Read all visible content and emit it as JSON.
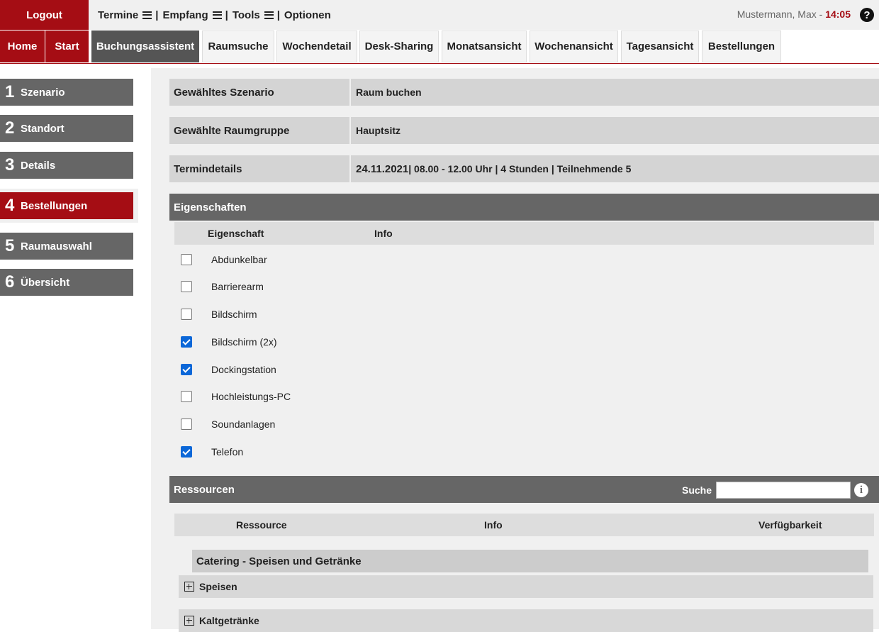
{
  "topbar": {
    "logout": "Logout",
    "menu": [
      {
        "label": "Termine",
        "sep": "|"
      },
      {
        "label": "Empfang",
        "sep": "|"
      },
      {
        "label": "Tools",
        "sep": "|"
      },
      {
        "label": "Optionen"
      }
    ],
    "user": "Mustermann, Max - ",
    "time": "14:05",
    "help": "?"
  },
  "tabs": [
    "Home",
    "Start",
    "Buchungsassistent",
    "Raumsuche",
    "Wochendetail",
    "Desk-Sharing",
    "Monatsansicht",
    "Wochenansicht",
    "Tagesansicht",
    "Bestellungen"
  ],
  "steps": [
    {
      "num": "1",
      "label": "Szenario"
    },
    {
      "num": "2",
      "label": "Standort"
    },
    {
      "num": "3",
      "label": "Details"
    },
    {
      "num": "4",
      "label": "Bestellungen"
    },
    {
      "num": "5",
      "label": "Raumauswahl"
    },
    {
      "num": "6",
      "label": "Übersicht"
    }
  ],
  "summary": {
    "scenario_key": "Gewähltes Szenario",
    "scenario_val": "Raum buchen",
    "group_key": "Gewählte Raumgruppe",
    "group_val": "Hauptsitz",
    "details_key": "Termindetails",
    "details_date": "24.11.2021",
    "details_rest": " | 08.00 - 12.00 Uhr | 4 Stunden | Teilnehmende 5"
  },
  "eigenschaften": {
    "title": "Eigenschaften",
    "col_prop": "Eigenschaft",
    "col_info": "Info",
    "items": [
      {
        "label": "Abdunkelbar",
        "checked": false
      },
      {
        "label": "Barrierearm",
        "checked": false
      },
      {
        "label": "Bildschirm",
        "checked": false
      },
      {
        "label": "Bildschirm (2x)",
        "checked": true
      },
      {
        "label": "Dockingstation",
        "checked": true
      },
      {
        "label": "Hochleistungs-PC",
        "checked": false
      },
      {
        "label": "Soundanlagen",
        "checked": false
      },
      {
        "label": "Telefon",
        "checked": true
      }
    ]
  },
  "ressourcen": {
    "title": "Ressourcen",
    "search_label": "Suche",
    "search_value": "",
    "col_res": "Ressource",
    "col_info": "Info",
    "col_avail": "Verfügbarkeit",
    "category": "Catering - Speisen und Getränke",
    "groups": [
      "Speisen",
      "Kaltgetränke"
    ]
  },
  "colors": {
    "accent": "#a50d14",
    "dark": "#666666",
    "check": "#0b67d8"
  }
}
